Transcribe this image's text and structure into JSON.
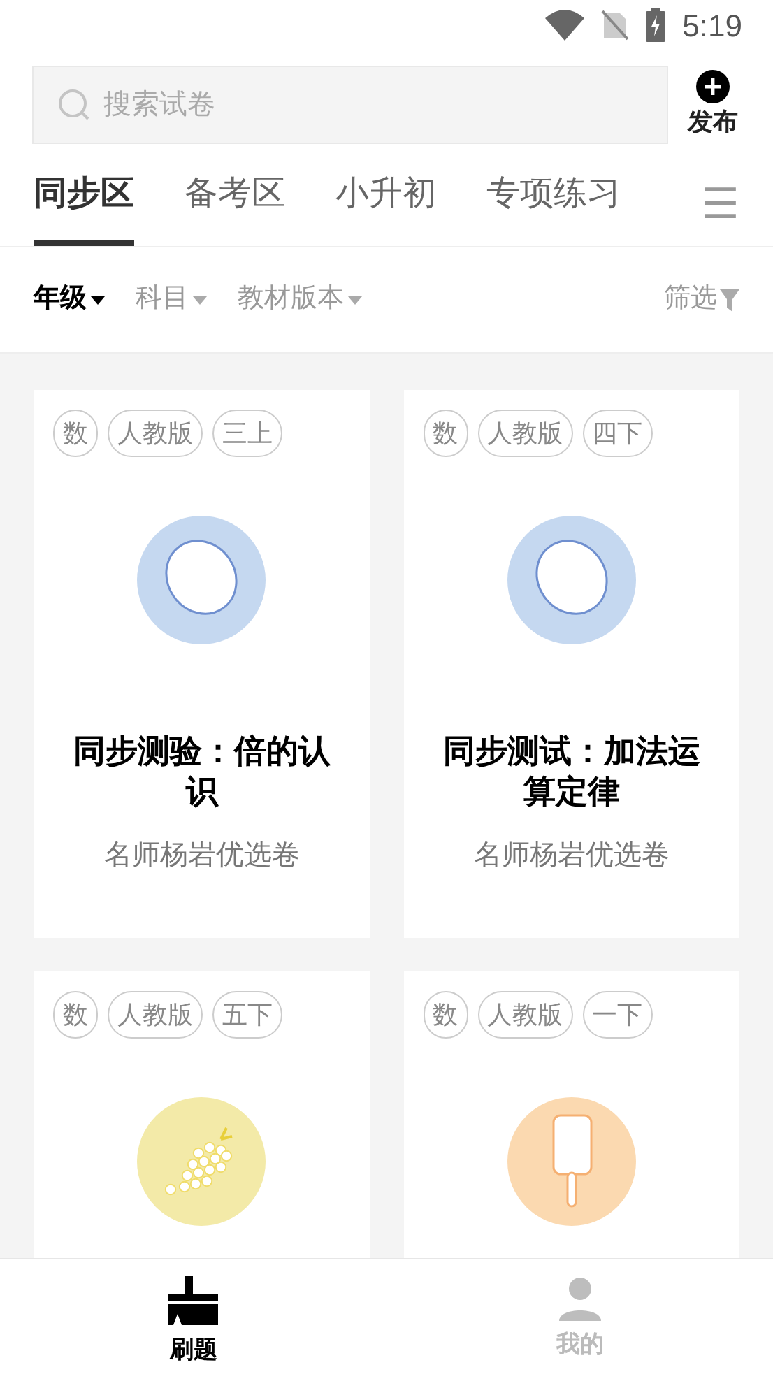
{
  "status_bar": {
    "time": "5:19"
  },
  "search": {
    "placeholder": "搜索试卷"
  },
  "publish": {
    "label": "发布"
  },
  "tabs": [
    {
      "label": "同步区",
      "selected": true
    },
    {
      "label": "备考区",
      "selected": false
    },
    {
      "label": "小升初",
      "selected": false
    },
    {
      "label": "专项练习",
      "selected": false
    }
  ],
  "menu": {
    "label": "☰"
  },
  "filters": [
    {
      "label": "年级",
      "selected": true
    },
    {
      "label": "科目",
      "selected": false
    },
    {
      "label": "教材版本",
      "selected": false
    }
  ],
  "filter_button": {
    "label": "筛选"
  },
  "cards": [
    {
      "tags": [
        "数",
        "人教版",
        "三上"
      ],
      "kind": "egg",
      "title": "同步测验：倍的认识",
      "author": "名师杨岩优选卷"
    },
    {
      "tags": [
        "数",
        "人教版",
        "四下"
      ],
      "kind": "egg",
      "title": "同步测试：加法运算定律",
      "author": "名师杨岩优选卷"
    },
    {
      "tags": [
        "数",
        "人教版",
        "五下"
      ],
      "kind": "grapes"
    },
    {
      "tags": [
        "数",
        "人教版",
        "一下"
      ],
      "kind": "popsicle"
    }
  ],
  "bottom_nav": [
    {
      "label": "刷题",
      "kind": "brush",
      "selected": true
    },
    {
      "label": "我的",
      "kind": "person",
      "selected": false
    }
  ]
}
